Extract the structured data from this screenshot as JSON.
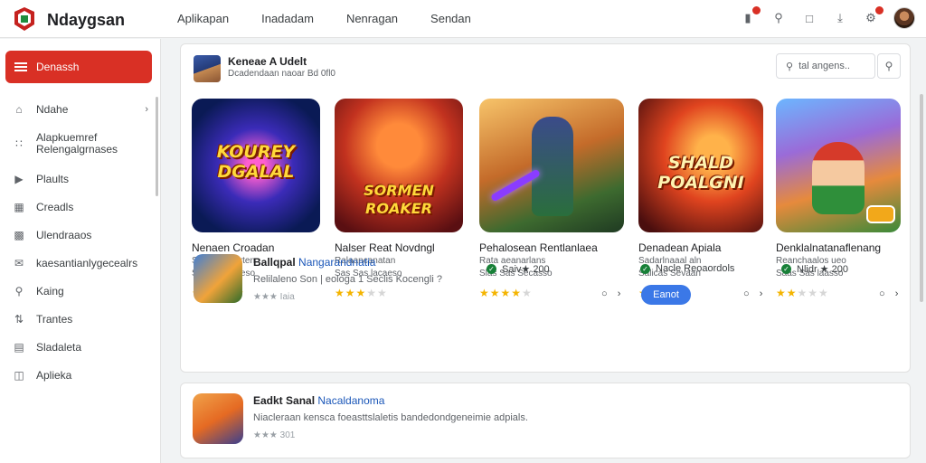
{
  "header": {
    "brand": "Ndaygsan",
    "nav": [
      "Aplikapan",
      "Inadadam",
      "Nenragan",
      "Sendan"
    ]
  },
  "sidebar": {
    "cta_label": "Denassh",
    "items": [
      {
        "label": "Ndahe",
        "icon": "home-icon"
      },
      {
        "label": "Alapkuemref\nRelengalgrnases",
        "icon": "apps-icon"
      },
      {
        "label": "Plaults",
        "icon": "play-icon"
      },
      {
        "label": "Creadls",
        "icon": "bookmark-icon"
      },
      {
        "label": "Ulendraaos",
        "icon": "chart-icon"
      },
      {
        "label": "kaesantianlygecealrs",
        "icon": "mail-icon"
      },
      {
        "label": "Kaing",
        "icon": "search-icon"
      },
      {
        "label": "Trantes",
        "icon": "tune-icon"
      },
      {
        "label": "Sladaleta",
        "icon": "list-icon"
      },
      {
        "label": "Aplieka",
        "icon": "bag-icon"
      }
    ]
  },
  "developer": {
    "title": "Keneae A Udelt",
    "subtitle": "Dcadendaan naoar Bd 0fl0"
  },
  "search": {
    "placeholder": "tal angens.."
  },
  "apps": [
    {
      "name": "Nenaen Croadan",
      "meta1": "Selacaadearten",
      "meta2": "Sas kai lacaeso",
      "art": "KOUREY DGALAL",
      "rating": 5
    },
    {
      "name": "Nalser Reat Novdngl",
      "meta1": "Ralaancanatan",
      "meta2": "Sas Sas lacaeso",
      "art": "SORMEN ROAKER",
      "rating": 3
    },
    {
      "name": "Pehalosean Rentlanlaea",
      "meta1": "Rata aeanarlans",
      "meta2": "Slas Sas Secasso",
      "art": "",
      "rating": 4
    },
    {
      "name": "Denadean Apiala",
      "meta1": "Sadarlnaaal aln",
      "meta2": "Salicas Sevaan",
      "art": "SHALD POALGNI",
      "rating": 3
    },
    {
      "name": "Denklalnatanaflenang",
      "meta1": "Reanchaalos ueo",
      "meta2": "Saas Sas laasso",
      "art": "",
      "rating": 2
    }
  ],
  "featured": {
    "title_bold": "Ballqpal",
    "title_link": "Nangarandnatia",
    "desc": "Relilaleno Son | eologa 1 Seclis Kocengli ?",
    "rating": "★★★ Iaia"
  },
  "stats": [
    {
      "text": "Saiv★ 200"
    },
    {
      "text": "Nacle Reoaordols"
    },
    {
      "text": "Nlidr ★ 200"
    }
  ],
  "open_button": "Eanot",
  "second": {
    "title_bold": "Eadkt Sanal",
    "title_link": "Nacaldanoma",
    "desc": "Niacleraan kensca foeasttslaletis bandedondgeneimie adpials.",
    "rating": "★★★ 301"
  }
}
